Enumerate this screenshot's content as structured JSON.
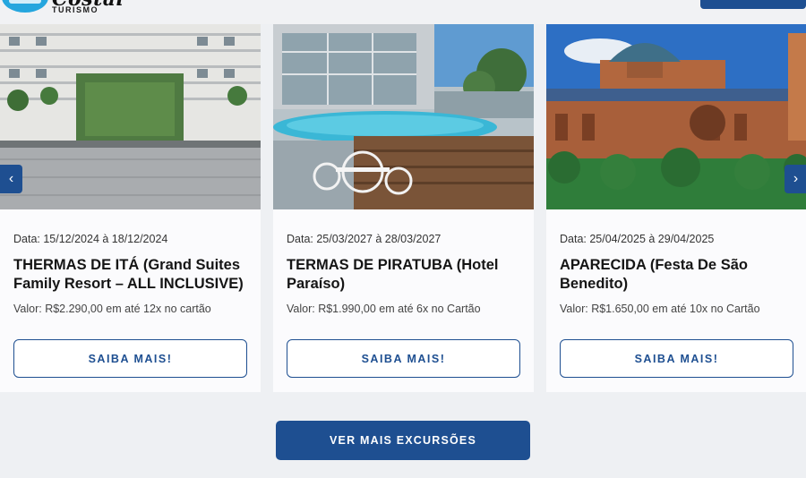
{
  "header": {
    "logo_word": "Costal",
    "logo_sub": "TURISMO",
    "top_mark": "´"
  },
  "carousel": {
    "prev_label": "‹",
    "next_label": "›",
    "cards": [
      {
        "photo": "resort-hotel-photo",
        "date": "Data: 15/12/2024 à 18/12/2024",
        "title": "THERMAS DE ITÁ (Grand Suites Family Resort – ALL INCLUSIVE)",
        "price": "Valor: R$2.290,00 em até 12x no cartão",
        "button": "SAIBA MAIS!"
      },
      {
        "photo": "pool-deck-photo",
        "date": "Data: 25/03/2027 à 28/03/2027",
        "title": "TERMAS DE PIRATUBA (Hotel Paraíso)",
        "price": "Valor: R$1.990,00 em até 6x no Cartão",
        "button": "SAIBA MAIS!"
      },
      {
        "photo": "basilica-photo",
        "date": "Data: 25/04/2025 à 29/04/2025",
        "title": "APARECIDA (Festa De São Benedito)",
        "price": "Valor: R$1.650,00 em até 10x no Cartão",
        "button": "SAIBA MAIS!"
      }
    ]
  },
  "more_button": "VER MAIS EXCURSÕES",
  "colors": {
    "brand_blue": "#1e4f91",
    "logo_blue": "#25a6de",
    "page_bg": "#eef0f3"
  }
}
